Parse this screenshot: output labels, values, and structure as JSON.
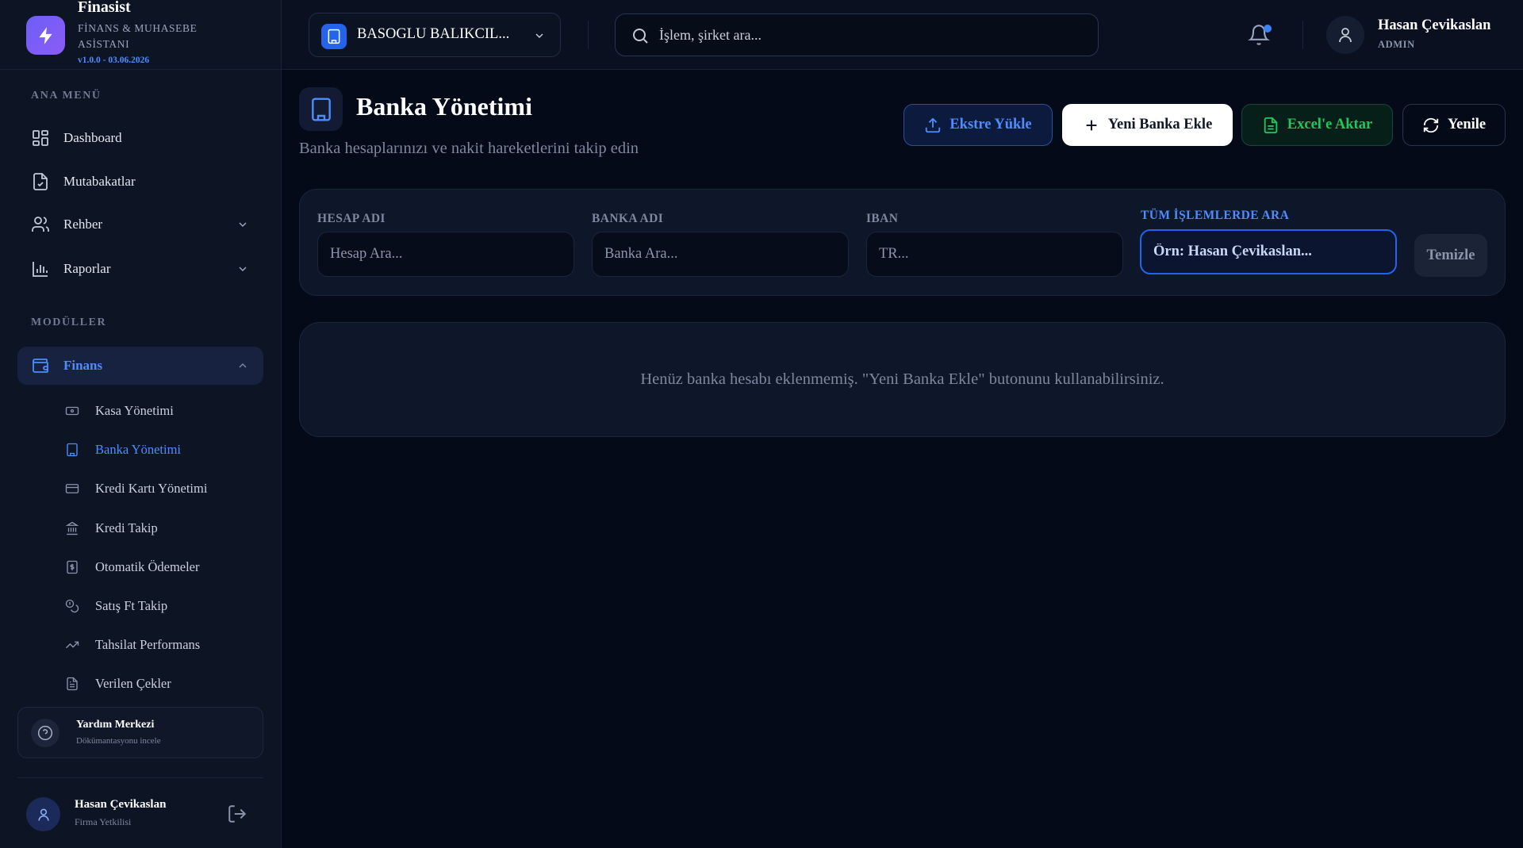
{
  "brand": {
    "name": "Finasist",
    "subtitle": "FİNANS & MUHASEBE ASİSTANI",
    "version": "v1.0.0 - 03.06.2026"
  },
  "sidebar": {
    "main_menu_title": "ANA MENÜ",
    "main_items": [
      {
        "label": "Dashboard",
        "icon": "dashboard-grid-icon"
      },
      {
        "label": "Mutabakatlar",
        "icon": "file-check-icon"
      },
      {
        "label": "Rehber",
        "icon": "users-icon",
        "expandable": true
      },
      {
        "label": "Raporlar",
        "icon": "bar-chart-icon",
        "expandable": true
      }
    ],
    "modules_title": "MODÜLLER",
    "modules": [
      {
        "label": "Finans",
        "icon": "wallet-icon",
        "expanded": true,
        "active": true
      }
    ],
    "finance_items": [
      {
        "label": "Kasa Yönetimi",
        "icon": "banknote-icon"
      },
      {
        "label": "Banka Yönetimi",
        "icon": "building-icon",
        "active": true
      },
      {
        "label": "Kredi Kartı Yönetimi",
        "icon": "credit-card-icon"
      },
      {
        "label": "Kredi Takip",
        "icon": "bank-icon"
      },
      {
        "label": "Otomatik Ödemeler",
        "icon": "receipt-dollar-icon"
      },
      {
        "label": "Satış Ft Takip",
        "icon": "coins-icon"
      },
      {
        "label": "Tahsilat Performans",
        "icon": "trending-up-icon"
      },
      {
        "label": "Verilen Çekler",
        "icon": "document-icon"
      }
    ],
    "help": {
      "title": "Yardım Merkezi",
      "subtitle": "Dökümantasyonu incele"
    },
    "user": {
      "name": "Hasan Çevikaslan",
      "role": "Firma Yetkilisi"
    }
  },
  "topbar": {
    "company": "BASOGLU BALIKCIL...",
    "search_placeholder": "İşlem, şirket ara...",
    "user_name": "Hasan Çevikaslan",
    "user_role": "ADMIN"
  },
  "page": {
    "title": "Banka Yönetimi",
    "subtitle": "Banka hesaplarınızı ve nakit hareketlerini takip edin",
    "buttons": {
      "upload": "Ekstre Yükle",
      "add": "Yeni Banka Ekle",
      "export": "Excel'e Aktar",
      "refresh": "Yenile"
    },
    "filters": {
      "account_label": "HESAP ADI",
      "account_placeholder": "Hesap Ara...",
      "bank_label": "BANKA ADI",
      "bank_placeholder": "Banka Ara...",
      "iban_label": "IBAN",
      "iban_placeholder": "TR...",
      "all_label": "TÜM İŞLEMLERDE ARA",
      "all_placeholder": "Örn: Hasan Çevikaslan...",
      "clear_label": "Temizle"
    },
    "empty_message": "Henüz banka hesabı eklenmemiş. \"Yeni Banka Ekle\" butonunu kullanabilirsiniz."
  },
  "colors": {
    "accent": "#4d8dff",
    "brand_gradient_start": "#6d5ef6",
    "success": "#22c55e",
    "background": "#050a18",
    "panel": "#0e1629"
  }
}
